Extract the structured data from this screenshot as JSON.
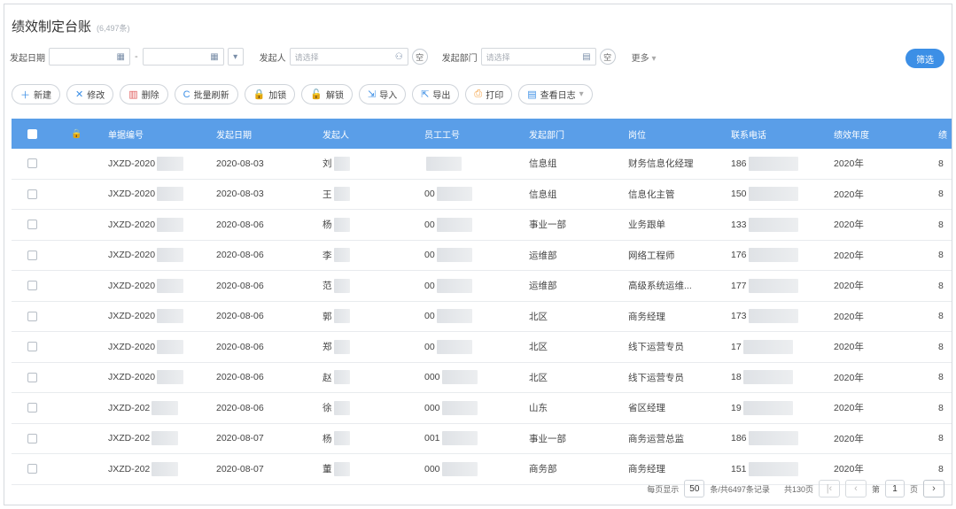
{
  "page": {
    "title": "绩效制定台账",
    "record_count": "(6,497条)"
  },
  "filters": {
    "date_label": "发起日期",
    "date_sep": "-",
    "initiator_label": "发起人",
    "initiator_placeholder": "请选择",
    "initiator_clear": "空",
    "dept_label": "发起部门",
    "dept_placeholder": "请选择",
    "dept_clear": "空",
    "more_label": "更多",
    "filter_button": "筛选"
  },
  "toolbar": [
    {
      "icon": "plus-icon",
      "glyph": "＋",
      "label": "新建"
    },
    {
      "icon": "edit-icon",
      "glyph": "✕",
      "label": "修改"
    },
    {
      "icon": "trash-icon",
      "glyph": "▥",
      "label": "删除"
    },
    {
      "icon": "refresh-icon",
      "glyph": "C",
      "label": "批量刷新"
    },
    {
      "icon": "lock-icon",
      "glyph": "🔒",
      "label": "加锁"
    },
    {
      "icon": "unlock-icon",
      "glyph": "🔓",
      "label": "解锁"
    },
    {
      "icon": "import-icon",
      "glyph": "⇲",
      "label": "导入"
    },
    {
      "icon": "export-icon",
      "glyph": "⇱",
      "label": "导出"
    },
    {
      "icon": "print-icon",
      "glyph": "⎙",
      "label": "打印"
    },
    {
      "icon": "log-icon",
      "glyph": "▤",
      "label": "查看日志"
    }
  ],
  "table": {
    "headers": [
      "单据编号",
      "发起日期",
      "发起人",
      "员工工号",
      "发起部门",
      "岗位",
      "联系电话",
      "绩效年度",
      "绩"
    ],
    "rows": [
      {
        "doc": "JXZD-2020",
        "date": "2020-08-03",
        "person": "刘",
        "emp": "",
        "dept": "信息组",
        "post": "财务信息化经理",
        "phone": "186",
        "year": "2020年",
        "extra": "8"
      },
      {
        "doc": "JXZD-2020",
        "date": "2020-08-03",
        "person": "王",
        "emp": "00",
        "dept": "信息组",
        "post": "信息化主管",
        "phone": "150",
        "year": "2020年",
        "extra": "8"
      },
      {
        "doc": "JXZD-2020",
        "date": "2020-08-06",
        "person": "杨",
        "emp": "00",
        "dept": "事业一部",
        "post": "业务跟单",
        "phone": "133",
        "year": "2020年",
        "extra": "8"
      },
      {
        "doc": "JXZD-2020",
        "date": "2020-08-06",
        "person": "李",
        "emp": "00",
        "dept": "运维部",
        "post": "网络工程师",
        "phone": "176",
        "year": "2020年",
        "extra": "8"
      },
      {
        "doc": "JXZD-2020",
        "date": "2020-08-06",
        "person": "范",
        "emp": "00",
        "dept": "运维部",
        "post": "高级系统运维...",
        "phone": "177",
        "year": "2020年",
        "extra": "8"
      },
      {
        "doc": "JXZD-2020",
        "date": "2020-08-06",
        "person": "郭",
        "emp": "00",
        "dept": "北区",
        "post": "商务经理",
        "phone": "173",
        "year": "2020年",
        "extra": "8"
      },
      {
        "doc": "JXZD-2020",
        "date": "2020-08-06",
        "person": "郑",
        "emp": "00",
        "dept": "北区",
        "post": "线下运营专员",
        "phone": "17",
        "year": "2020年",
        "extra": "8"
      },
      {
        "doc": "JXZD-2020",
        "date": "2020-08-06",
        "person": "赵",
        "emp": "000",
        "dept": "北区",
        "post": "线下运营专员",
        "phone": "18",
        "year": "2020年",
        "extra": "8"
      },
      {
        "doc": "JXZD-202",
        "date": "2020-08-06",
        "person": "徐",
        "emp": "000",
        "dept": "山东",
        "post": "省区经理",
        "phone": "19",
        "year": "2020年",
        "extra": "8"
      },
      {
        "doc": "JXZD-202",
        "date": "2020-08-07",
        "person": "杨",
        "emp": "001",
        "dept": "事业一部",
        "post": "商务运营总监",
        "phone": "186",
        "year": "2020年",
        "extra": "8"
      },
      {
        "doc": "JXZD-202",
        "date": "2020-08-07",
        "person": "董",
        "emp": "000",
        "dept": "商务部",
        "post": "商务经理",
        "phone": "151",
        "year": "2020年",
        "extra": "8"
      }
    ]
  },
  "pagination": {
    "per_page_label": "每页显示",
    "per_page": "50",
    "total_label": "条/共6497条记录",
    "pages_label": "共130页",
    "page_prefix": "第",
    "page_num": "1",
    "page_suffix": "页"
  },
  "colors": {
    "header_bg": "#5a9ee8",
    "accent": "#3c8fe6"
  }
}
